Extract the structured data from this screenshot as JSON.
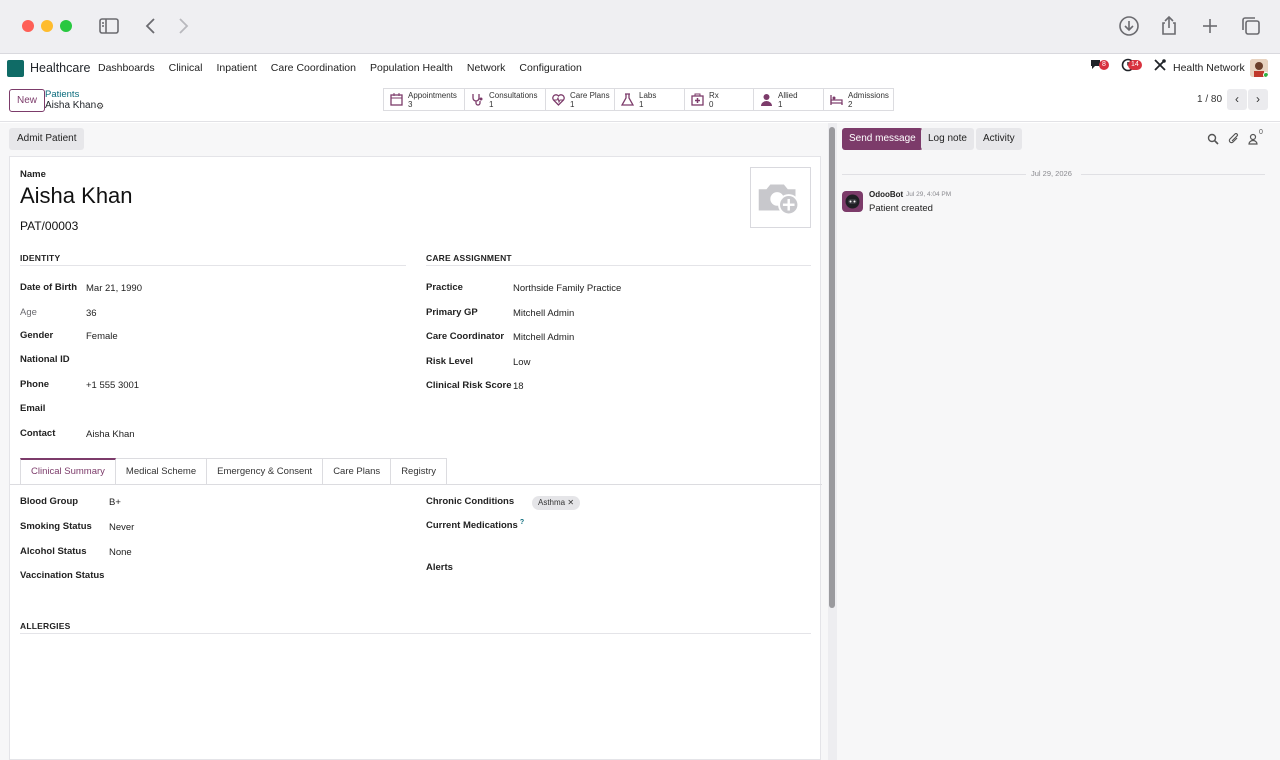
{
  "browser": {
    "icons": [
      "sidebar-icon",
      "back-icon",
      "forward-icon",
      "download-icon",
      "share-icon",
      "new-tab-icon",
      "tabs-overview-icon"
    ]
  },
  "navbar": {
    "app_name": "Healthcare",
    "menu": [
      "Dashboards",
      "Clinical",
      "Inpatient",
      "Care Coordination",
      "Population Health",
      "Network",
      "Configuration"
    ],
    "chat_badge": "8",
    "activity_badge": "14",
    "company": "Health Network"
  },
  "control": {
    "new_label": "New",
    "breadcrumb_parent": "Patients",
    "breadcrumb_current": "Aisha Khan",
    "smart_buttons": [
      {
        "label": "Appointments",
        "count": "3"
      },
      {
        "label": "Consultations",
        "count": "1"
      },
      {
        "label": "Care Plans",
        "count": "1"
      },
      {
        "label": "Labs",
        "count": "1"
      },
      {
        "label": "Rx",
        "count": "0"
      },
      {
        "label": "Allied",
        "count": "1"
      },
      {
        "label": "Admissions",
        "count": "2"
      }
    ],
    "pager": "1 / 80"
  },
  "form": {
    "admit_label": "Admit Patient",
    "name_label": "Name",
    "patient_name": "Aisha Khan",
    "patient_ref": "PAT/00003",
    "identity_title": "IDENTITY",
    "identity": [
      {
        "label": "Date of Birth",
        "value": "Mar 21, 1990"
      },
      {
        "label": "Age",
        "value": "36"
      },
      {
        "label": "Gender",
        "value": "Female"
      },
      {
        "label": "National ID",
        "value": ""
      },
      {
        "label": "Phone",
        "value": "+1 555 3001"
      },
      {
        "label": "Email",
        "value": ""
      },
      {
        "label": "Contact",
        "value": "Aisha Khan"
      }
    ],
    "care_title": "CARE ASSIGNMENT",
    "care": [
      {
        "label": "Practice",
        "value": "Northside Family Practice"
      },
      {
        "label": "Primary GP",
        "value": "Mitchell Admin"
      },
      {
        "label": "Care Coordinator",
        "value": "Mitchell Admin"
      },
      {
        "label": "Risk Level",
        "value": "Low"
      },
      {
        "label": "Clinical Risk Score",
        "value": "18"
      }
    ],
    "tabs": [
      "Clinical Summary",
      "Medical Scheme",
      "Emergency & Consent",
      "Care Plans",
      "Registry"
    ],
    "clinical_left": [
      {
        "label": "Blood Group",
        "value": "B+"
      },
      {
        "label": "Smoking Status",
        "value": "Never"
      },
      {
        "label": "Alcohol Status",
        "value": "None"
      },
      {
        "label": "Vaccination Status",
        "value": ""
      }
    ],
    "chronic_label": "Chronic Conditions",
    "chronic_tag": "Asthma ✕",
    "medications_label": "Current Medications",
    "medications_help": "?",
    "alerts_label": "Alerts",
    "allergies_title": "ALLERGIES"
  },
  "chatter": {
    "send_label": "Send message",
    "log_label": "Log note",
    "activity_label": "Activity",
    "followers": "0",
    "date": "Jul 29, 2026",
    "author": "OdooBot",
    "time": "Jul 29, 4:04 PM",
    "body": "Patient created"
  },
  "colors": {
    "brand": "#7c3b6a",
    "teal": "#0f6b66",
    "badge": "#d8323f"
  }
}
